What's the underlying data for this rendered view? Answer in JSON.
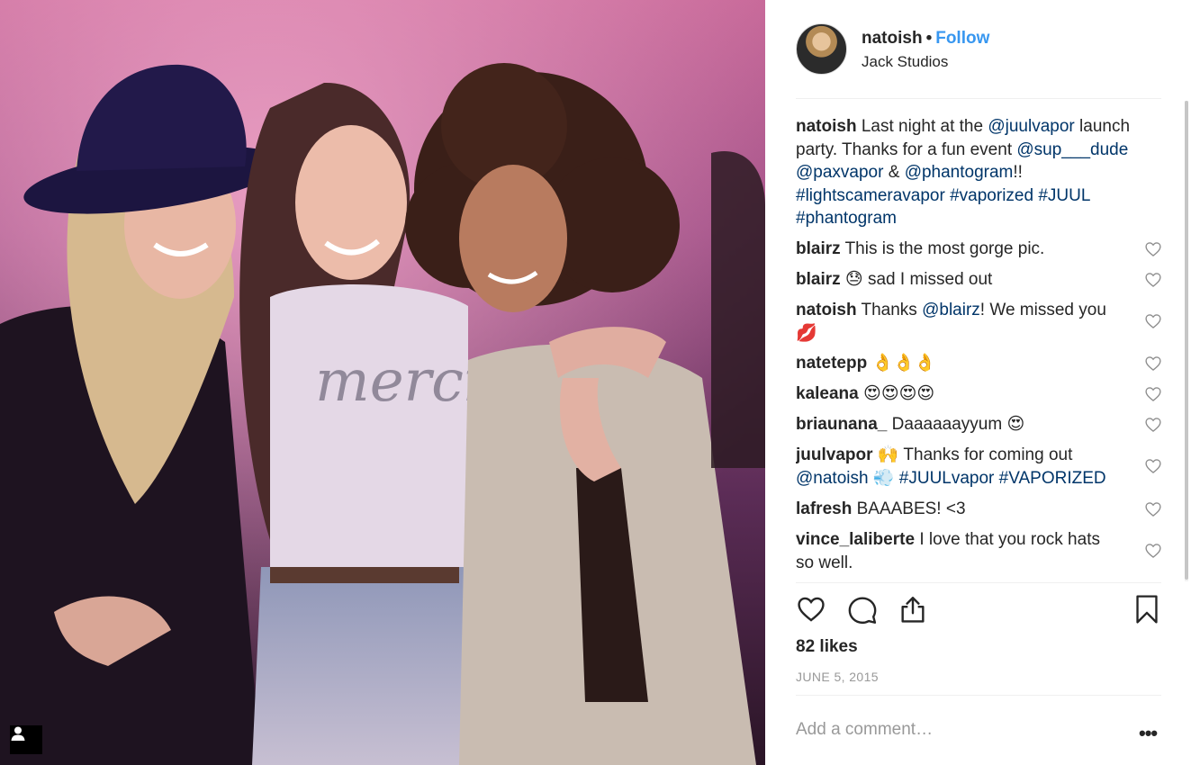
{
  "post": {
    "username": "natoish",
    "separator": "•",
    "follow_label": "Follow",
    "location": "Jack Studios",
    "caption": {
      "user": "natoish",
      "p1": "Last night at the ",
      "m1": "@juulvapor",
      "p2": " launch party. Thanks for a fun event ",
      "m2": "@sup___dude",
      "p3": " ",
      "m3": "@paxvapor",
      "p4": " & ",
      "m4": "@phantogram",
      "p5": "!! ",
      "t1": "#lightscameravapor",
      "p6": " ",
      "t2": "#vaporized",
      "p7": " ",
      "t3": "#JUUL",
      "p8": " ",
      "t4": "#phantogram"
    },
    "comments": [
      {
        "user": "blairz",
        "text": "This is the most gorge pic."
      },
      {
        "user": "blairz",
        "text": "😓 sad I missed out"
      },
      {
        "user": "natoish",
        "pre": "Thanks ",
        "mention": "@blairz",
        "post": "! We missed you 💋"
      },
      {
        "user": "natetepp",
        "text": "👌👌👌"
      },
      {
        "user": "kaleana",
        "text": "😍😍😍😍"
      },
      {
        "user": "briaunana_",
        "text": "Daaaaaayyum 😍"
      },
      {
        "user": "juulvapor",
        "pre": "🙌 Thanks for coming out ",
        "mention": "@natoish",
        "mid": " 💨 ",
        "tag1": "#JUULvapor",
        "sp": " ",
        "tag2": "#VAPORIZED"
      },
      {
        "user": "lafresh",
        "text": "BAAABES! <3"
      },
      {
        "user": "vince_laliberte",
        "text": "I love that you rock hats so well."
      }
    ],
    "likes": "82 likes",
    "date": "JUNE 5, 2015",
    "add_comment_placeholder": "Add a comment…",
    "more_label": "•••"
  },
  "icons": {
    "like": "heart-icon",
    "comment": "comment-icon",
    "share": "share-icon",
    "save": "bookmark-icon",
    "tag": "person-tag-icon",
    "comment_like": "heart-icon"
  },
  "colors": {
    "link": "#003569",
    "follow": "#3897f0",
    "muted": "#999999",
    "text": "#262626"
  }
}
